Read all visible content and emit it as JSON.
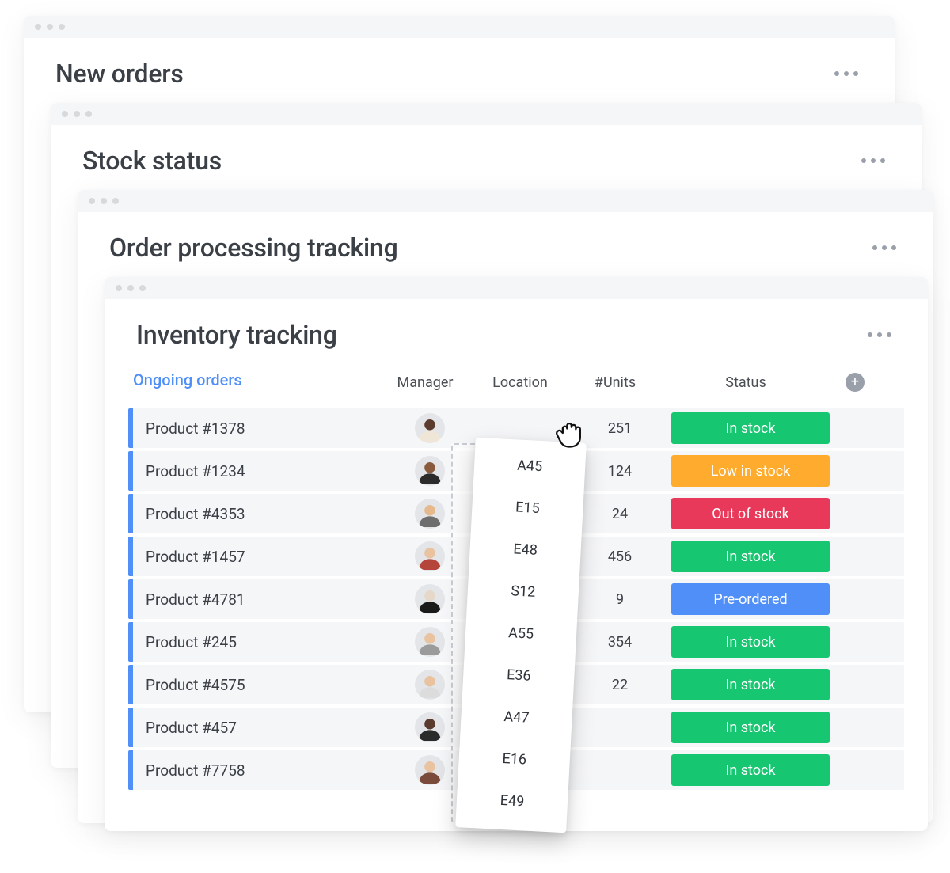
{
  "windows": {
    "w1": {
      "title": "New orders"
    },
    "w2": {
      "title": "Stock status"
    },
    "w3": {
      "title": "Order processing tracking"
    },
    "w4": {
      "title": "Inventory tracking"
    }
  },
  "section_label": "Ongoing orders",
  "columns": {
    "manager": "Manager",
    "location": "Location",
    "units": "#Units",
    "status": "Status"
  },
  "status_labels": {
    "in_stock": "In stock",
    "low": "Low in stock",
    "out": "Out of stock",
    "pre": "Pre-ordered"
  },
  "status_colors": {
    "in_stock": "#17c671",
    "low": "#ffab2d",
    "out": "#e8395a",
    "pre": "#4f8ff7"
  },
  "rows": [
    {
      "product": "Product  #1378",
      "location": "A45",
      "units": "251",
      "status": "in_stock",
      "avatar": 0
    },
    {
      "product": "Product  #1234",
      "location": "E15",
      "units": "124",
      "status": "low",
      "avatar": 1
    },
    {
      "product": "Product  #4353",
      "location": "E48",
      "units": "24",
      "status": "out",
      "avatar": 2
    },
    {
      "product": "Product  #1457",
      "location": "S12",
      "units": "456",
      "status": "in_stock",
      "avatar": 3
    },
    {
      "product": "Product  #4781",
      "location": "A55",
      "units": "9",
      "status": "pre",
      "avatar": 4
    },
    {
      "product": "Product  #245",
      "location": "E36",
      "units": "354",
      "status": "in_stock",
      "avatar": 5
    },
    {
      "product": "Product  #4575",
      "location": "A47",
      "units": "22",
      "status": "in_stock",
      "avatar": 6
    },
    {
      "product": "Product  #457",
      "location": "E16",
      "units": "",
      "status": "in_stock",
      "avatar": 7
    },
    {
      "product": "Product  #7758",
      "location": "E49",
      "units": "",
      "status": "in_stock",
      "avatar": 8
    }
  ],
  "avatar_palette": [
    {
      "skin": "#5a3b2e",
      "shirt": "#f0e6d8"
    },
    {
      "skin": "#8a5a3c",
      "shirt": "#2b2b2b"
    },
    {
      "skin": "#e6b98c",
      "shirt": "#6e6e6e"
    },
    {
      "skin": "#e9c3a0",
      "shirt": "#b5453a"
    },
    {
      "skin": "#e6d8c8",
      "shirt": "#1a1a1a"
    },
    {
      "skin": "#e9c3a0",
      "shirt": "#9b9b9b"
    },
    {
      "skin": "#e9c3a0",
      "shirt": "#dcdcdc"
    },
    {
      "skin": "#5a3b2e",
      "shirt": "#2b2b2b"
    },
    {
      "skin": "#e9c3a0",
      "shirt": "#7a4a3a"
    }
  ]
}
